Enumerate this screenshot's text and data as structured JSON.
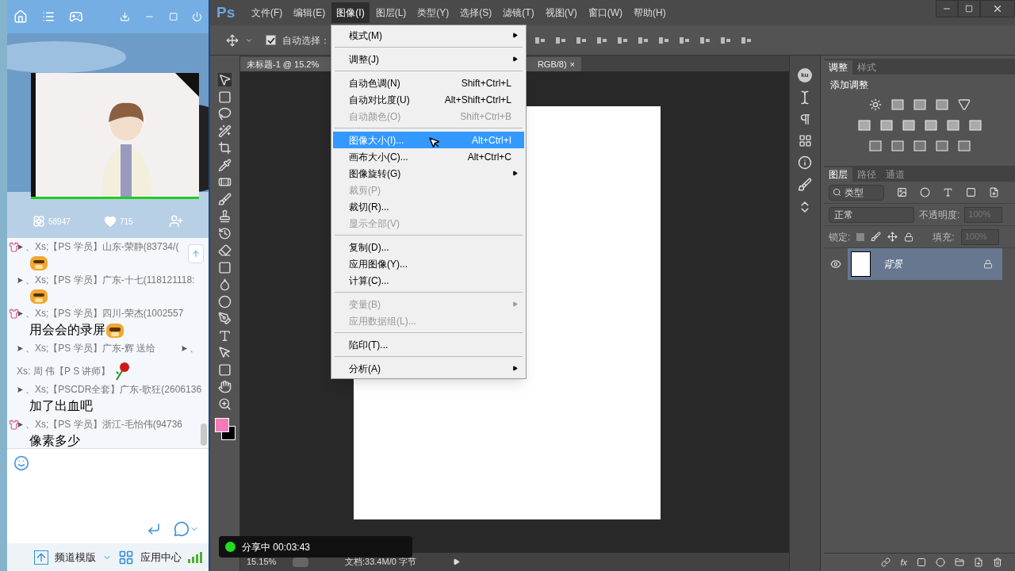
{
  "chat_app": {
    "stats": [
      {
        "kind": "flowers",
        "value": "58947"
      },
      {
        "kind": "likes",
        "value": "715"
      }
    ],
    "messages": [
      {
        "kind": "chat",
        "vip": true,
        "sender": "、Xs;【PS  学员】山东-荣静(83734/(",
        "emoji": {
          "kind": "tiger"
        }
      },
      {
        "kind": "chat",
        "vip": false,
        "sender": "、Xs;【PS  学员】广东-十七(118121118:",
        "emoji": {
          "kind": "tiger"
        }
      },
      {
        "kind": "chat",
        "vip": true,
        "sender": "、Xs;【PS  学员】四川-荣杰(1002557",
        "body": "用会会的录屏",
        "emoji": {
          "kind": "cool_tiger"
        }
      },
      {
        "kind": "gift",
        "vip": false,
        "sender": "、Xs;【PS  学员】广东-辉 送给",
        "recipient_prefix": "、",
        "recipient": "Xs:  周  伟【P S 讲师】",
        "emoji": {
          "kind": "rose"
        }
      },
      {
        "kind": "chat",
        "vip": false,
        "sender": "、Xs;【PSCDR全套】广东-歌狂(2606136",
        "body": "加了出血吧"
      },
      {
        "kind": "chat",
        "vip": true,
        "sender": "、Xs;【PS  学员】浙江-毛怡伟(94736",
        "body": "像素多少"
      }
    ],
    "bottom_bar": {
      "template": "频道模版",
      "app_center": "应用中心"
    }
  },
  "photoshop": {
    "logo": "Ps",
    "menus": [
      {
        "label": "文件(F)",
        "selected": false
      },
      {
        "label": "编辑(E)",
        "selected": false
      },
      {
        "label": "图像(I)",
        "selected": true
      },
      {
        "label": "图层(L)",
        "selected": false
      },
      {
        "label": "类型(Y)",
        "selected": false
      },
      {
        "label": "选择(S)",
        "selected": false
      },
      {
        "label": "滤镜(T)",
        "selected": false
      },
      {
        "label": "视图(V)",
        "selected": false
      },
      {
        "label": "窗口(W)",
        "selected": false
      },
      {
        "label": "帮助(H)",
        "selected": false
      }
    ],
    "auto_select": {
      "label": "自动选择：",
      "checked": true
    },
    "document_tab": {
      "title": "未标题-1 @ 15.2%",
      "title_end": "RGB/8)",
      "close": "×"
    },
    "dropdown": [
      {
        "kind": "item",
        "label": "模式(M)",
        "submenu": true,
        "disabled": false,
        "selected": false
      },
      {
        "kind": "separator"
      },
      {
        "kind": "item",
        "label": "调整(J)",
        "submenu": true,
        "disabled": false,
        "selected": false
      },
      {
        "kind": "separator"
      },
      {
        "kind": "item",
        "label": "自动色调(N)",
        "shortcut": "Shift+Ctrl+L",
        "submenu": false,
        "disabled": false,
        "selected": false
      },
      {
        "kind": "item",
        "label": "自动对比度(U)",
        "shortcut": "Alt+Shift+Ctrl+L",
        "submenu": false,
        "disabled": false,
        "selected": false
      },
      {
        "kind": "item",
        "label": "自动颜色(O)",
        "shortcut": "Shift+Ctrl+B",
        "submenu": false,
        "disabled": true,
        "selected": false
      },
      {
        "kind": "separator"
      },
      {
        "kind": "item",
        "label": "图像大小(I)...",
        "shortcut": "Alt+Ctrl+I",
        "submenu": false,
        "disabled": false,
        "selected": true
      },
      {
        "kind": "item",
        "label": "画布大小(C)...",
        "shortcut": "Alt+Ctrl+C",
        "submenu": false,
        "disabled": false,
        "selected": false
      },
      {
        "kind": "item",
        "label": "图像旋转(G)",
        "submenu": true,
        "disabled": false,
        "selected": false
      },
      {
        "kind": "item",
        "label": "裁剪(P)",
        "submenu": false,
        "disabled": true,
        "selected": false
      },
      {
        "kind": "item",
        "label": "裁切(R)...",
        "submenu": false,
        "disabled": false,
        "selected": false
      },
      {
        "kind": "item",
        "label": "显示全部(V)",
        "submenu": false,
        "disabled": true,
        "selected": false
      },
      {
        "kind": "separator"
      },
      {
        "kind": "item",
        "label": "复制(D)...",
        "submenu": false,
        "disabled": false,
        "selected": false
      },
      {
        "kind": "item",
        "label": "应用图像(Y)...",
        "submenu": false,
        "disabled": false,
        "selected": false
      },
      {
        "kind": "item",
        "label": "计算(C)...",
        "submenu": false,
        "disabled": false,
        "selected": false
      },
      {
        "kind": "separator"
      },
      {
        "kind": "item",
        "label": "变量(B)",
        "submenu": true,
        "disabled": true,
        "selected": false
      },
      {
        "kind": "item",
        "label": "应用数据组(L)...",
        "submenu": false,
        "disabled": true,
        "selected": false
      },
      {
        "kind": "separator"
      },
      {
        "kind": "item",
        "label": "陷印(T)...",
        "submenu": false,
        "disabled": false,
        "selected": false
      },
      {
        "kind": "separator"
      },
      {
        "kind": "item",
        "label": "分析(A)",
        "submenu": true,
        "disabled": false,
        "selected": false
      }
    ],
    "side_badge": "ku",
    "adjustments": {
      "tabs": [
        {
          "label": "调整",
          "selected": true
        },
        {
          "label": "样式",
          "selected": false
        }
      ],
      "heading": "添加调整"
    },
    "layers": {
      "tabs": [
        {
          "label": "图层",
          "selected": true
        },
        {
          "label": "路径",
          "selected": false
        },
        {
          "label": "通道",
          "selected": false
        }
      ],
      "filter": "类型",
      "blend": "正常",
      "opacity_label": "不透明度:",
      "opacity": "100%",
      "lock_label": "锁定:",
      "fill_label": "填充:",
      "fill": "100%",
      "items": [
        {
          "name": "背景",
          "selected": true,
          "visible": true,
          "locked": true
        }
      ],
      "fx": "fx"
    },
    "recording": {
      "on": true,
      "label": "分享中 00:03:43"
    },
    "status": {
      "zoom": "15.15%",
      "doc": "文档:33.4M/0 字节"
    }
  }
}
